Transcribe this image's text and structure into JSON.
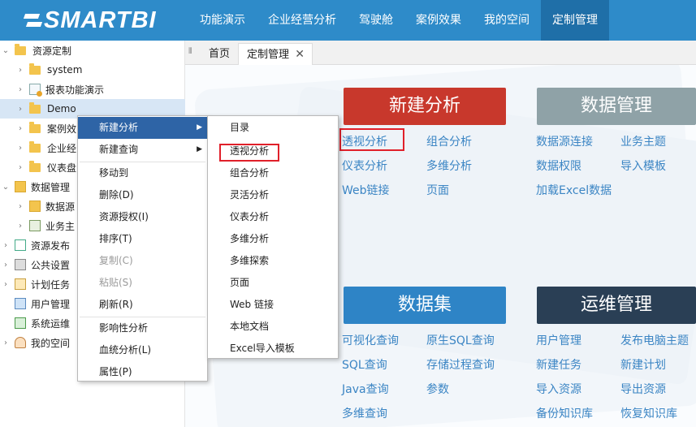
{
  "brand": {
    "name": "SMARTBI"
  },
  "nav": [
    {
      "label": "功能演示"
    },
    {
      "label": "企业经营分析"
    },
    {
      "label": "驾驶舱"
    },
    {
      "label": "案例效果"
    },
    {
      "label": "我的空间"
    },
    {
      "label": "定制管理",
      "active": true
    }
  ],
  "tree": [
    {
      "label": "资源定制"
    },
    {
      "label": "system"
    },
    {
      "label": "报表功能演示"
    },
    {
      "label": "Demo"
    },
    {
      "label": "案例效"
    },
    {
      "label": "企业经"
    },
    {
      "label": "仪表盘"
    },
    {
      "label": "数据管理"
    },
    {
      "label": "数据源"
    },
    {
      "label": "业务主"
    },
    {
      "label": "资源发布"
    },
    {
      "label": "公共设置"
    },
    {
      "label": "计划任务"
    },
    {
      "label": "用户管理"
    },
    {
      "label": "系统运维"
    },
    {
      "label": "我的空间"
    }
  ],
  "tabs": {
    "home": "首页",
    "active": "定制管理",
    "close": "✕"
  },
  "blocks": {
    "new_analysis": {
      "title": "新建分析",
      "links": [
        "透视分析",
        "组合分析",
        "仪表分析",
        "多维分析",
        "Web链接",
        "页面"
      ]
    },
    "data_mgmt": {
      "title": "数据管理",
      "links": [
        "数据源连接",
        "业务主题",
        "数据权限",
        "导入模板",
        "加载Excel数据"
      ]
    },
    "dataset": {
      "title": "数据集",
      "links": [
        "可视化查询",
        "原生SQL查询",
        "SQL查询",
        "存储过程查询",
        "Java查询",
        "参数",
        "多维查询"
      ]
    },
    "ops": {
      "title": "运维管理",
      "links": [
        "用户管理",
        "发布电脑主题",
        "新建任务",
        "新建计划",
        "导入资源",
        "导出资源",
        "备份知识库",
        "恢复知识库"
      ]
    }
  },
  "context_menu": [
    {
      "label": "新建分析",
      "submenu": true,
      "hover": true
    },
    {
      "label": "新建查询",
      "submenu": true
    },
    {
      "label": "移动到"
    },
    {
      "label": "删除(D)"
    },
    {
      "label": "资源授权(I)"
    },
    {
      "label": "排序(T)"
    },
    {
      "label": "复制(C)",
      "disabled": true
    },
    {
      "label": "粘贴(S)",
      "disabled": true
    },
    {
      "label": "刷新(R)"
    },
    {
      "label": "影响性分析"
    },
    {
      "label": "血统分析(L)"
    },
    {
      "label": "属性(P)"
    }
  ],
  "submenu": [
    {
      "label": "目录"
    },
    {
      "label": "透视分析",
      "highlighted": true
    },
    {
      "label": "组合分析"
    },
    {
      "label": "灵活分析"
    },
    {
      "label": "仪表分析"
    },
    {
      "label": "多维分析"
    },
    {
      "label": "多维探索"
    },
    {
      "label": "页面"
    },
    {
      "label": "Web 链接"
    },
    {
      "label": "本地文档"
    },
    {
      "label": "Excel导入模板"
    }
  ],
  "colors": {
    "topbar": "#2e8bc9",
    "new_analysis": "#c8382c",
    "data_mgmt": "#8fa2a7",
    "dataset": "#2e84c6",
    "ops": "#2a3f55",
    "link": "#3b85c4",
    "highlight": "#e0202a"
  }
}
